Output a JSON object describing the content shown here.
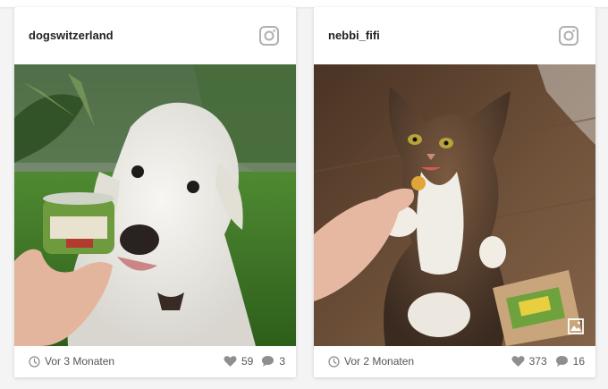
{
  "posts": [
    {
      "username": "dogswitzerland",
      "time": "Vor 3 Monaten",
      "likes": "59",
      "comments": "3"
    },
    {
      "username": "nebbi_fifi",
      "time": "Vor 2 Monaten",
      "likes": "373",
      "comments": "16"
    }
  ],
  "colors": {
    "icon_gray": "#b0b0b0",
    "text": "#222222",
    "muted": "#555555"
  },
  "icons": {
    "network": "instagram-icon",
    "time": "clock-icon",
    "likes": "heart-icon",
    "comments": "comment-icon",
    "gallery": "gallery-icon"
  }
}
